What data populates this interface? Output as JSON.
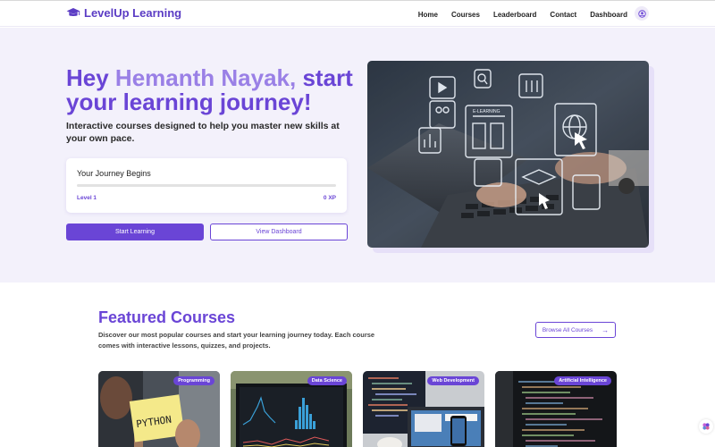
{
  "header": {
    "brand": "LevelUp Learning",
    "nav": [
      "Home",
      "Courses",
      "Leaderboard",
      "Contact",
      "Dashboard"
    ]
  },
  "hero": {
    "greeting": "Hey ",
    "user_name": "Hemanth Nayak,",
    "greeting_rest": " start your learning journey!",
    "subtitle": "Interactive courses designed to help you master new skills at your own pace.",
    "journey": {
      "title": "Your Journey Begins",
      "level": "Level 1",
      "xp": "0 XP",
      "progress": 0
    },
    "start_button": "Start Learning",
    "dashboard_button": "View Dashboard"
  },
  "featured": {
    "title": "Featured Courses",
    "description": "Discover our most popular courses and start your learning journey today. Each course comes with interactive lessons, quizzes, and projects.",
    "browse_button": "Browse All Courses",
    "courses": [
      {
        "tag": "Programming",
        "note_text": "PYTHON"
      },
      {
        "tag": "Data Science"
      },
      {
        "tag": "Web Development"
      },
      {
        "tag": "Artificial Intelligence"
      }
    ]
  },
  "colors": {
    "accent": "#6a45d6",
    "accent_light": "#9a80e6",
    "hero_bg": "#f3f1fb"
  },
  "icons": {
    "logo": "graduation-cap-icon",
    "user": "user-circle-icon",
    "browse_arrow": "arrow-right-icon",
    "floating": "palette-icon"
  }
}
